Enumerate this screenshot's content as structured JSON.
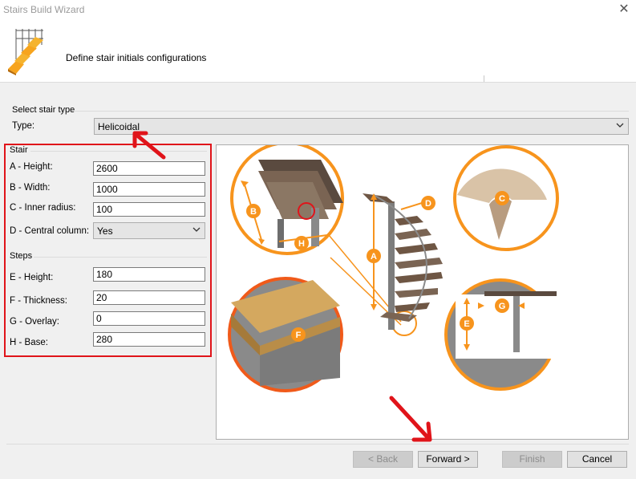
{
  "window": {
    "title": "Stairs Build Wizard",
    "close_glyph": "✕"
  },
  "header": {
    "description": "Define stair initials configurations",
    "icon": "stairs-icon"
  },
  "stair_type": {
    "group_label": "Select stair type",
    "type_label": "Type:",
    "type_value": "Helicoidal"
  },
  "stair": {
    "group_label": "Stair",
    "fields": [
      {
        "label": "A - Height:",
        "value": "2600"
      },
      {
        "label": "B - Width:",
        "value": "1000"
      },
      {
        "label": "C - Inner radius:",
        "value": "100"
      }
    ],
    "central_column": {
      "label": "D - Central column:",
      "value": "Yes"
    }
  },
  "steps": {
    "group_label": "Steps",
    "fields": [
      {
        "label": "E - Height:",
        "value": "180"
      },
      {
        "label": "F - Thickness:",
        "value": "20"
      },
      {
        "label": "G - Overlay:",
        "value": "0"
      },
      {
        "label": "H - Base:",
        "value": "280"
      }
    ]
  },
  "diagram_letters": {
    "a": "A",
    "b": "B",
    "c": "C",
    "d": "D",
    "e": "E",
    "f": "F",
    "g": "G",
    "h": "H"
  },
  "buttons": {
    "back": "< Back",
    "forward": "Forward >",
    "finish": "Finish",
    "cancel": "Cancel"
  },
  "colors": {
    "accent": "#f7941d",
    "annotation_red": "#e0141a"
  }
}
